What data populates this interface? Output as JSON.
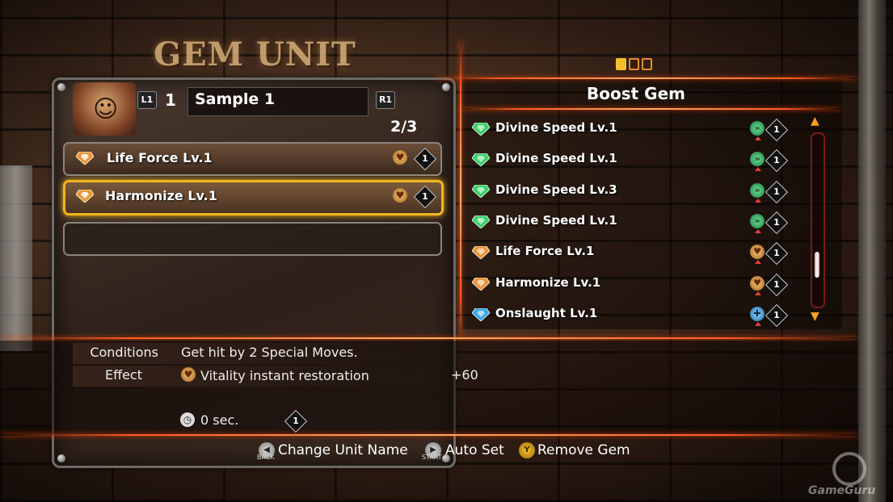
{
  "screen_title": "GEM UNIT",
  "page_indicator": {
    "total": 3,
    "active": 1
  },
  "unit": {
    "l1_label": "L1",
    "r1_label": "R1",
    "number": "1",
    "name": "Sample 1",
    "capacity": "2/3",
    "slots": [
      {
        "label": "Life Force Lv.1",
        "gem_color": "orange",
        "icon": "heart-icon",
        "cost": "1",
        "selected": false
      },
      {
        "label": "Harmonize Lv.1",
        "gem_color": "orange",
        "icon": "heart-icon",
        "cost": "1",
        "selected": true
      },
      {
        "label": "",
        "empty": true
      }
    ]
  },
  "boost_panel": {
    "title": "Boost Gem",
    "items": [
      {
        "label": "Divine Speed Lv.1",
        "gem_color": "green",
        "icon": "speed-icon",
        "cost": "1"
      },
      {
        "label": "Divine Speed Lv.1",
        "gem_color": "green",
        "icon": "speed-icon",
        "cost": "1"
      },
      {
        "label": "Divine Speed Lv.3",
        "gem_color": "green",
        "icon": "speed-icon",
        "cost": "1"
      },
      {
        "label": "Divine Speed Lv.1",
        "gem_color": "green",
        "icon": "speed-icon",
        "cost": "1"
      },
      {
        "label": "Life Force Lv.1",
        "gem_color": "orange",
        "icon": "heart-icon",
        "cost": "1"
      },
      {
        "label": "Harmonize Lv.1",
        "gem_color": "orange",
        "icon": "heart-icon",
        "cost": "1"
      },
      {
        "label": "Onslaught Lv.1",
        "gem_color": "blue",
        "icon": "cross-icon",
        "cost": "1"
      }
    ]
  },
  "details": {
    "conditions_label": "Conditions",
    "conditions_text": "Get hit by 2 Special Moves.",
    "effect_label": "Effect",
    "effect_text": "Vitality instant restoration",
    "effect_value": "+60",
    "duration": "0 sec.",
    "cost": "1"
  },
  "footer": {
    "back_sub": "BACK",
    "back_label": "Change Unit Name",
    "start_sub": "START",
    "start_label": "Auto Set",
    "y_glyph": "Y",
    "y_label": "Remove Gem"
  },
  "watermark": "GameGuru",
  "colors": {
    "accent_orange": "#ff5a1e",
    "selection_gold": "#f2b520",
    "gem_orange": "#e8963a",
    "gem_green": "#3fcf6a",
    "gem_blue": "#3aa8e8"
  }
}
